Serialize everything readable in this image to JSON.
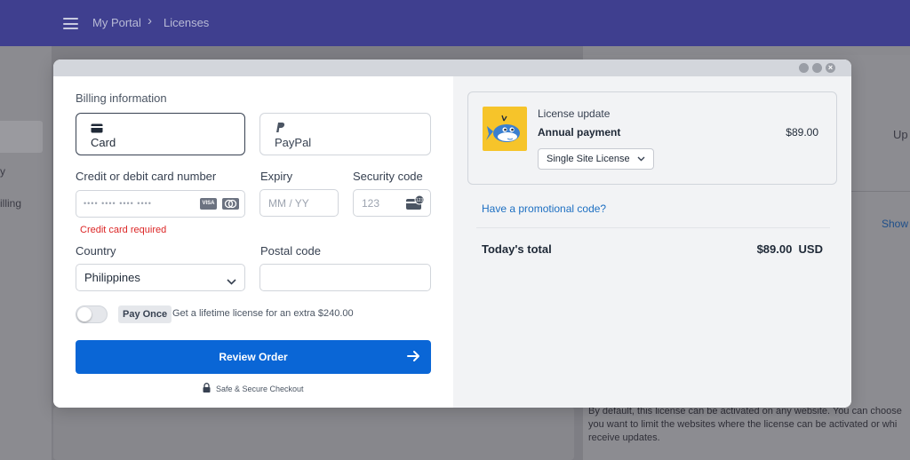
{
  "header": {
    "breadcrumb": [
      "My Portal",
      "Licenses"
    ],
    "background_color": "#3f3f8f"
  },
  "background": {
    "sidebar_fragments": [
      "y",
      "illing"
    ],
    "right_fragments": [
      "Up",
      "Show"
    ],
    "description": "By default, this license can be activated on any website. You can choose to limit the websites where the license can be activated or which websites receive updates.",
    "description_lines": [
      "By default, this license can be activated on any website. You can choose",
      "you want to limit the websites where the license can be activated or whi",
      "receive updates."
    ]
  },
  "checkout": {
    "section_title": "Billing information",
    "payment_tabs": [
      {
        "label": "Card",
        "icon": "credit-card-icon",
        "selected": true
      },
      {
        "label": "PayPal",
        "icon": "paypal-icon",
        "selected": false
      }
    ],
    "card_number": {
      "label": "Credit or debit card number",
      "placeholder": "•••• •••• •••• ••••",
      "brands": [
        "VISA",
        "MC"
      ],
      "error": "Credit card required"
    },
    "expiry": {
      "label": "Expiry",
      "placeholder": "MM / YY"
    },
    "security_code": {
      "label": "Security code",
      "placeholder": "123",
      "icon": "cvc-card-icon"
    },
    "country": {
      "label": "Country",
      "value": "Philippines"
    },
    "postal_code": {
      "label": "Postal code",
      "value": ""
    },
    "pay_once": {
      "badge": "Pay Once",
      "description": "Get a lifetime license for an extra $240.00",
      "enabled": false
    },
    "submit": {
      "label": "Review Order",
      "color": "#0a66d6"
    },
    "secure_note": "Safe & Secure Checkout"
  },
  "summary": {
    "product": {
      "title": "License update",
      "plan": "Annual payment",
      "price": "$89.00",
      "license_option": "Single Site License",
      "logo_color": "#f6c42a"
    },
    "promo_link": "Have a promotional code?",
    "total_label": "Today's total",
    "total_value": "$89.00  USD"
  }
}
